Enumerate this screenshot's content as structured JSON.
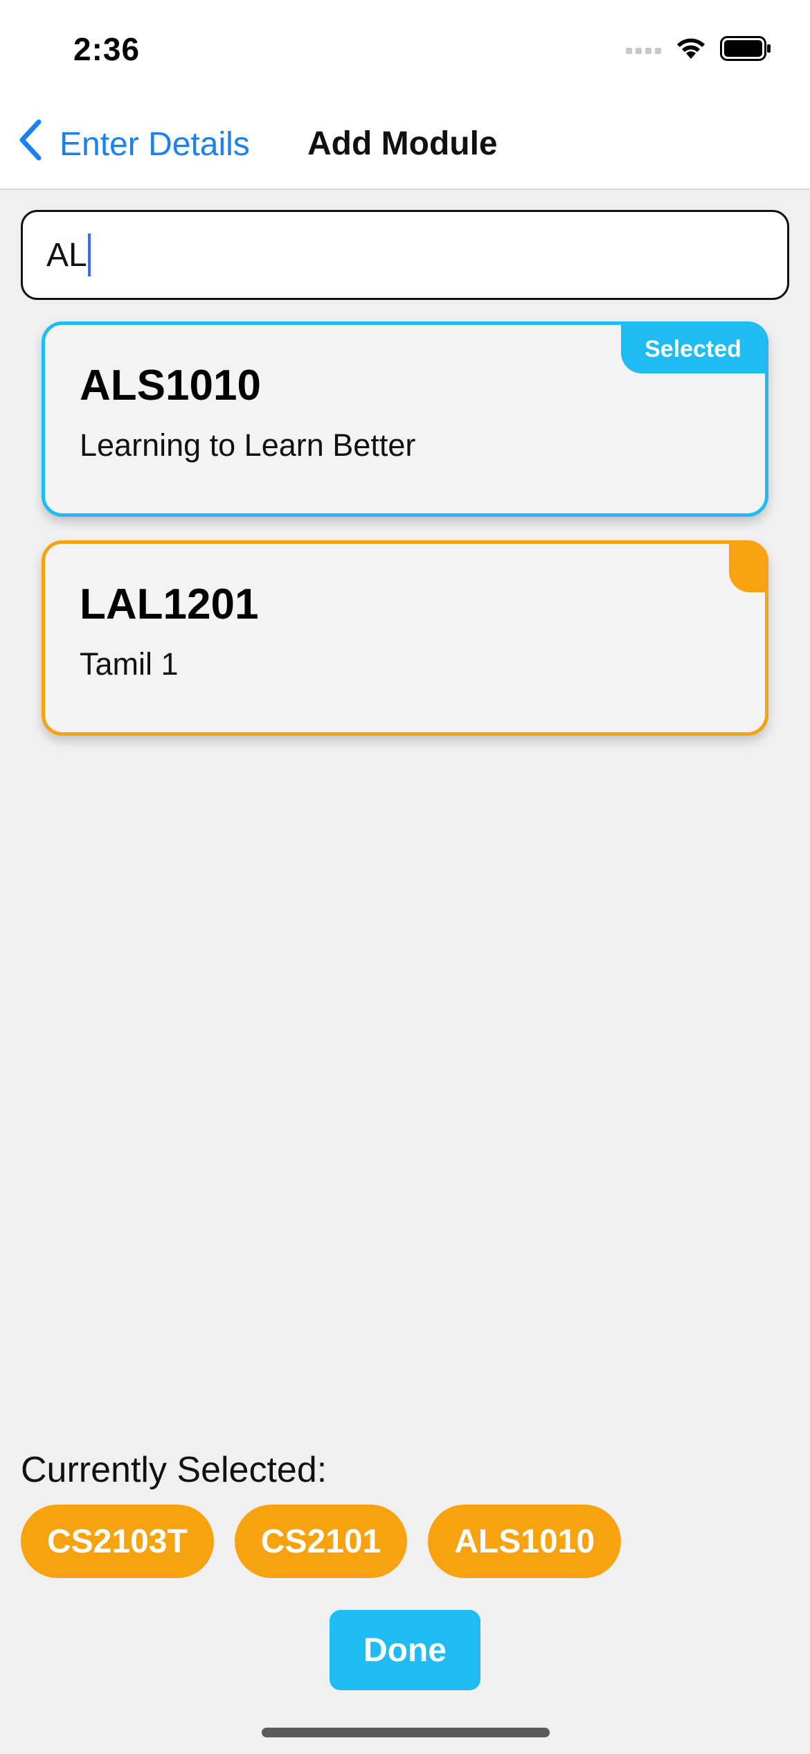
{
  "status_bar": {
    "time": "2:36",
    "icons": [
      "cellular-signal-icon",
      "wifi-icon",
      "battery-icon"
    ]
  },
  "nav": {
    "back_label": "Enter Details",
    "title": "Add Module"
  },
  "search": {
    "value": "AL"
  },
  "results": [
    {
      "code": "ALS1010",
      "name": "Learning to Learn Better",
      "tag": "Selected",
      "selected": true
    },
    {
      "code": "LAL1201",
      "name": "Tamil 1",
      "tag": "",
      "selected": false
    }
  ],
  "currently_selected": {
    "label": "Currently Selected:",
    "modules": [
      "CS2103T",
      "CS2101",
      "ALS1010"
    ]
  },
  "done_label": "Done",
  "colors": {
    "accent_blue": "#1ebcf2",
    "accent_orange": "#f7a20f",
    "link_blue": "#1a82f0"
  }
}
